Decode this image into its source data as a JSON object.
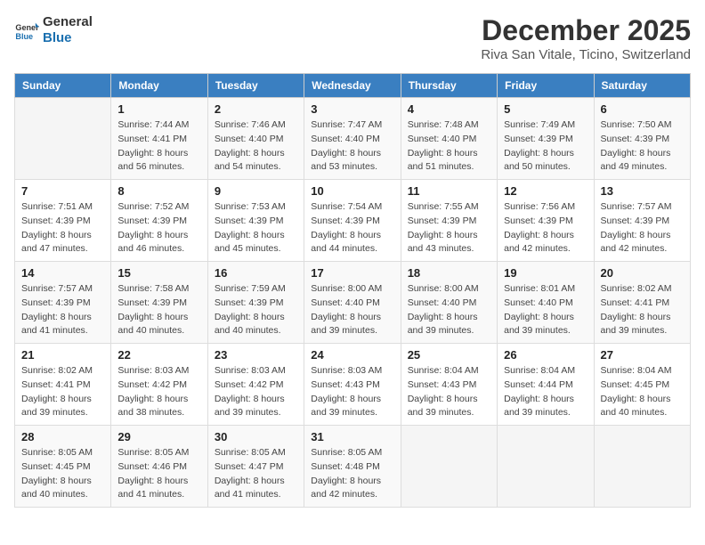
{
  "header": {
    "logo_line1": "General",
    "logo_line2": "Blue",
    "month": "December 2025",
    "location": "Riva San Vitale, Ticino, Switzerland"
  },
  "days_of_week": [
    "Sunday",
    "Monday",
    "Tuesday",
    "Wednesday",
    "Thursday",
    "Friday",
    "Saturday"
  ],
  "weeks": [
    [
      {
        "day": "",
        "sunrise": "",
        "sunset": "",
        "daylight": ""
      },
      {
        "day": "1",
        "sunrise": "7:44 AM",
        "sunset": "4:41 PM",
        "daylight": "8 hours and 56 minutes."
      },
      {
        "day": "2",
        "sunrise": "7:46 AM",
        "sunset": "4:40 PM",
        "daylight": "8 hours and 54 minutes."
      },
      {
        "day": "3",
        "sunrise": "7:47 AM",
        "sunset": "4:40 PM",
        "daylight": "8 hours and 53 minutes."
      },
      {
        "day": "4",
        "sunrise": "7:48 AM",
        "sunset": "4:40 PM",
        "daylight": "8 hours and 51 minutes."
      },
      {
        "day": "5",
        "sunrise": "7:49 AM",
        "sunset": "4:39 PM",
        "daylight": "8 hours and 50 minutes."
      },
      {
        "day": "6",
        "sunrise": "7:50 AM",
        "sunset": "4:39 PM",
        "daylight": "8 hours and 49 minutes."
      }
    ],
    [
      {
        "day": "7",
        "sunrise": "7:51 AM",
        "sunset": "4:39 PM",
        "daylight": "8 hours and 47 minutes."
      },
      {
        "day": "8",
        "sunrise": "7:52 AM",
        "sunset": "4:39 PM",
        "daylight": "8 hours and 46 minutes."
      },
      {
        "day": "9",
        "sunrise": "7:53 AM",
        "sunset": "4:39 PM",
        "daylight": "8 hours and 45 minutes."
      },
      {
        "day": "10",
        "sunrise": "7:54 AM",
        "sunset": "4:39 PM",
        "daylight": "8 hours and 44 minutes."
      },
      {
        "day": "11",
        "sunrise": "7:55 AM",
        "sunset": "4:39 PM",
        "daylight": "8 hours and 43 minutes."
      },
      {
        "day": "12",
        "sunrise": "7:56 AM",
        "sunset": "4:39 PM",
        "daylight": "8 hours and 42 minutes."
      },
      {
        "day": "13",
        "sunrise": "7:57 AM",
        "sunset": "4:39 PM",
        "daylight": "8 hours and 42 minutes."
      }
    ],
    [
      {
        "day": "14",
        "sunrise": "7:57 AM",
        "sunset": "4:39 PM",
        "daylight": "8 hours and 41 minutes."
      },
      {
        "day": "15",
        "sunrise": "7:58 AM",
        "sunset": "4:39 PM",
        "daylight": "8 hours and 40 minutes."
      },
      {
        "day": "16",
        "sunrise": "7:59 AM",
        "sunset": "4:39 PM",
        "daylight": "8 hours and 40 minutes."
      },
      {
        "day": "17",
        "sunrise": "8:00 AM",
        "sunset": "4:40 PM",
        "daylight": "8 hours and 39 minutes."
      },
      {
        "day": "18",
        "sunrise": "8:00 AM",
        "sunset": "4:40 PM",
        "daylight": "8 hours and 39 minutes."
      },
      {
        "day": "19",
        "sunrise": "8:01 AM",
        "sunset": "4:40 PM",
        "daylight": "8 hours and 39 minutes."
      },
      {
        "day": "20",
        "sunrise": "8:02 AM",
        "sunset": "4:41 PM",
        "daylight": "8 hours and 39 minutes."
      }
    ],
    [
      {
        "day": "21",
        "sunrise": "8:02 AM",
        "sunset": "4:41 PM",
        "daylight": "8 hours and 39 minutes."
      },
      {
        "day": "22",
        "sunrise": "8:03 AM",
        "sunset": "4:42 PM",
        "daylight": "8 hours and 38 minutes."
      },
      {
        "day": "23",
        "sunrise": "8:03 AM",
        "sunset": "4:42 PM",
        "daylight": "8 hours and 39 minutes."
      },
      {
        "day": "24",
        "sunrise": "8:03 AM",
        "sunset": "4:43 PM",
        "daylight": "8 hours and 39 minutes."
      },
      {
        "day": "25",
        "sunrise": "8:04 AM",
        "sunset": "4:43 PM",
        "daylight": "8 hours and 39 minutes."
      },
      {
        "day": "26",
        "sunrise": "8:04 AM",
        "sunset": "4:44 PM",
        "daylight": "8 hours and 39 minutes."
      },
      {
        "day": "27",
        "sunrise": "8:04 AM",
        "sunset": "4:45 PM",
        "daylight": "8 hours and 40 minutes."
      }
    ],
    [
      {
        "day": "28",
        "sunrise": "8:05 AM",
        "sunset": "4:45 PM",
        "daylight": "8 hours and 40 minutes."
      },
      {
        "day": "29",
        "sunrise": "8:05 AM",
        "sunset": "4:46 PM",
        "daylight": "8 hours and 41 minutes."
      },
      {
        "day": "30",
        "sunrise": "8:05 AM",
        "sunset": "4:47 PM",
        "daylight": "8 hours and 41 minutes."
      },
      {
        "day": "31",
        "sunrise": "8:05 AM",
        "sunset": "4:48 PM",
        "daylight": "8 hours and 42 minutes."
      },
      {
        "day": "",
        "sunrise": "",
        "sunset": "",
        "daylight": ""
      },
      {
        "day": "",
        "sunrise": "",
        "sunset": "",
        "daylight": ""
      },
      {
        "day": "",
        "sunrise": "",
        "sunset": "",
        "daylight": ""
      }
    ]
  ]
}
